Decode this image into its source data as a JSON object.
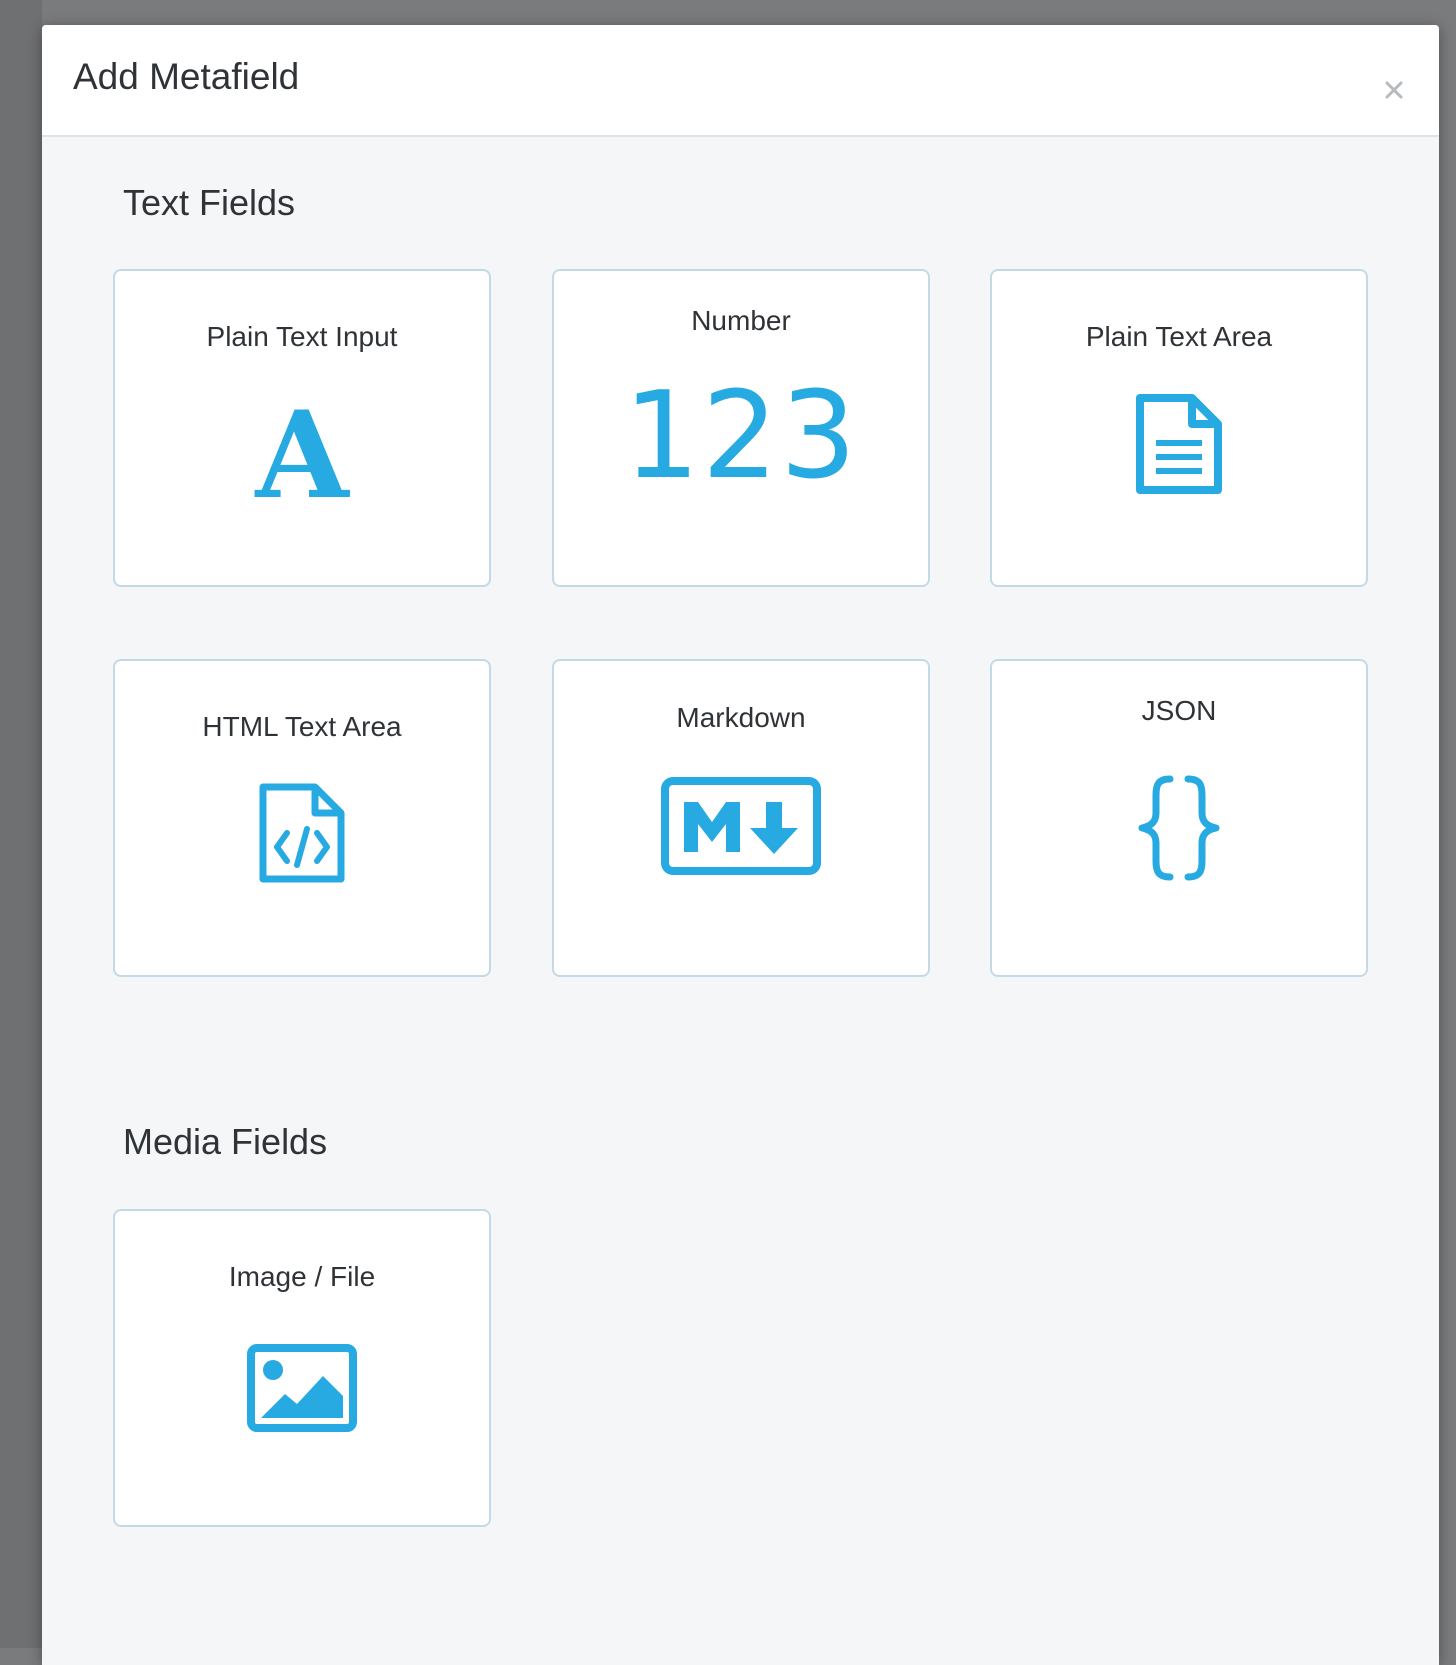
{
  "modal": {
    "title": "Add Metafield",
    "close_label": "×"
  },
  "sections": [
    {
      "title": "Text Fields",
      "items": [
        {
          "label": "Plain Text Input",
          "icon": "letter-a-icon",
          "icon_text": "A"
        },
        {
          "label": "Number",
          "icon": "number-123-icon",
          "icon_text": "123"
        },
        {
          "label": "Plain Text Area",
          "icon": "document-icon"
        },
        {
          "label": "HTML Text Area",
          "icon": "code-file-icon"
        },
        {
          "label": "Markdown",
          "icon": "markdown-icon"
        },
        {
          "label": "JSON",
          "icon": "curly-braces-icon"
        }
      ]
    },
    {
      "title": "Media Fields",
      "items": [
        {
          "label": "Image / File",
          "icon": "image-icon"
        }
      ]
    }
  ],
  "colors": {
    "accent": "#27aae1",
    "card_border": "#c4d9e6",
    "modal_body": "#f4f6f8",
    "backdrop": "#7a7b7d"
  }
}
